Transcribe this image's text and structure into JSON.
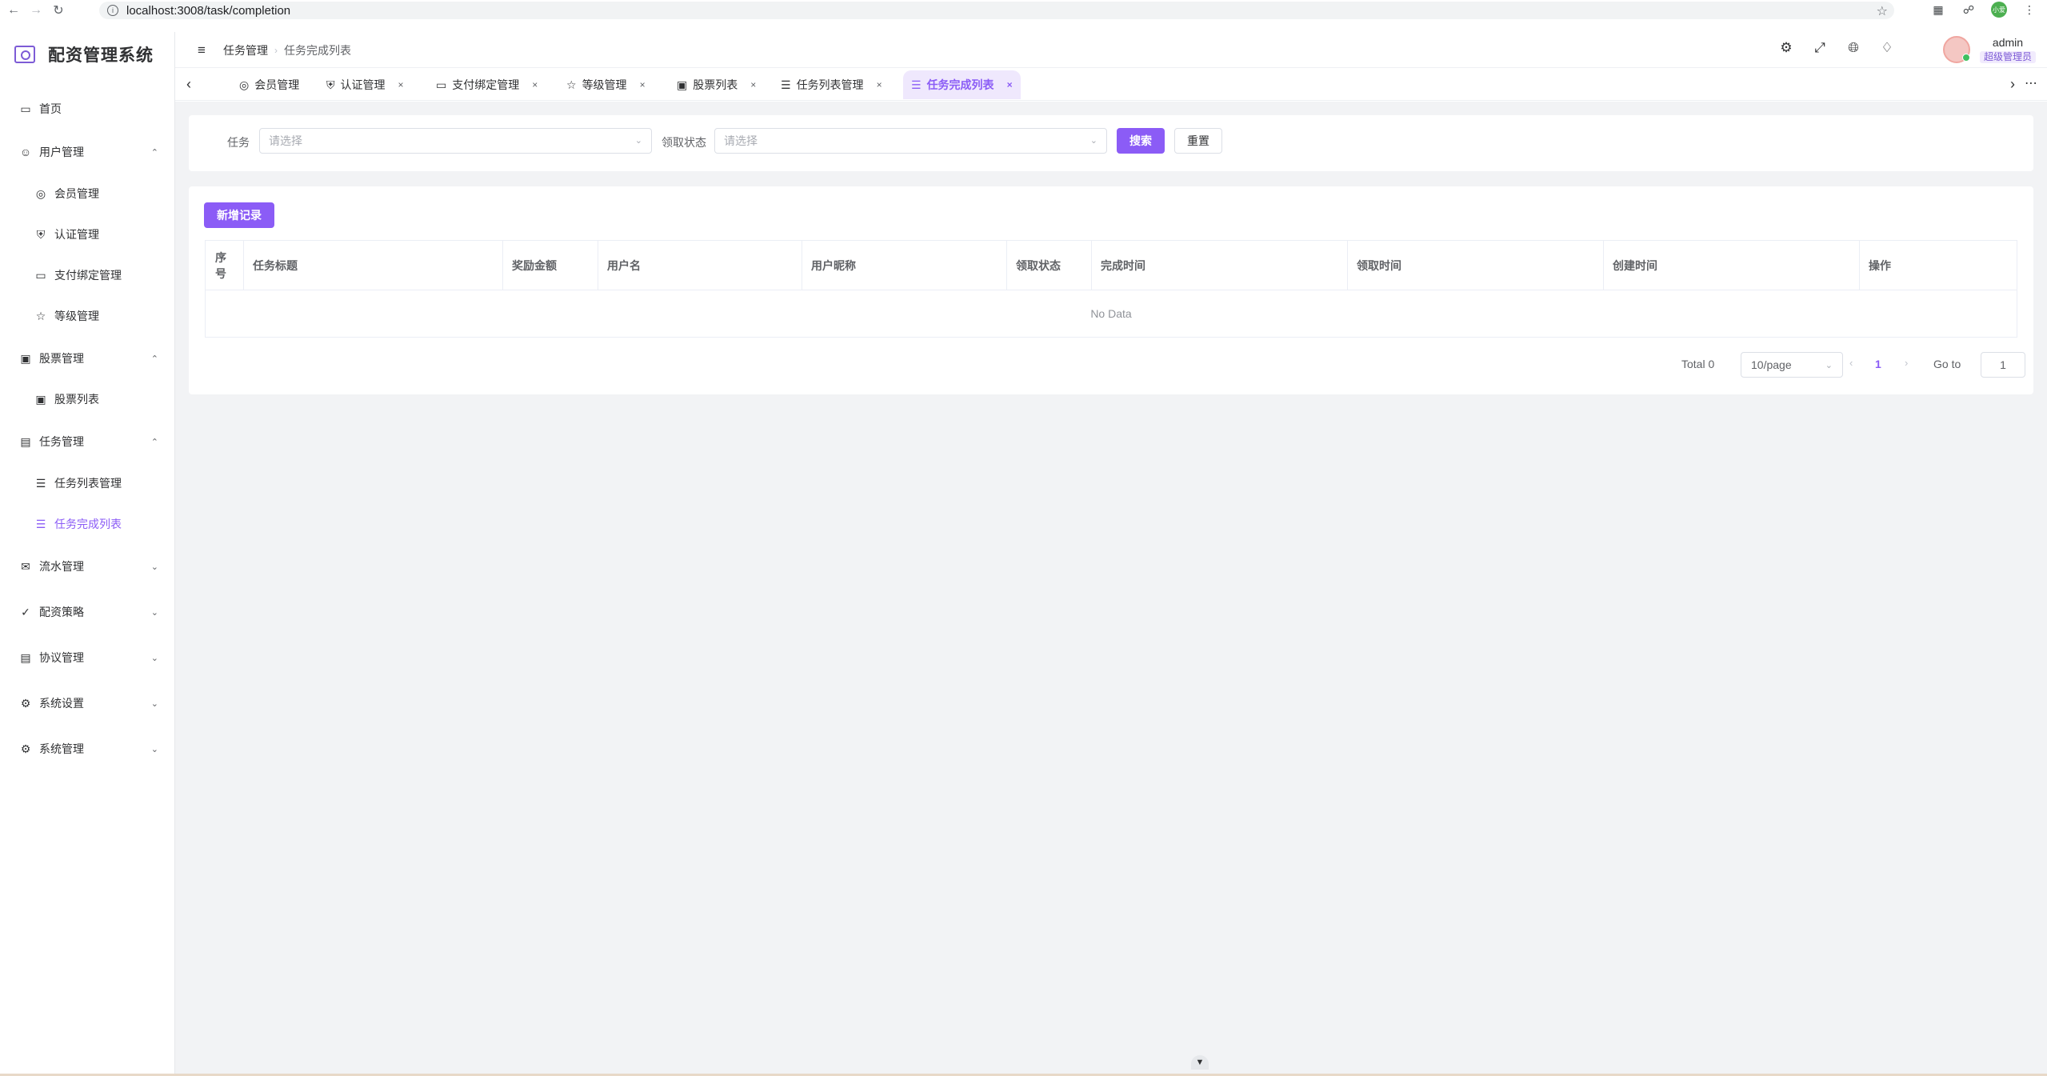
{
  "browser": {
    "url": "localhost:3008/task/completion",
    "profile_label": "小爱"
  },
  "app": {
    "title": "配资管理系统"
  },
  "sidebar": {
    "items": [
      {
        "label": "首页",
        "icon": "monitor-icon",
        "level": 1,
        "caret": ""
      },
      {
        "label": "用户管理",
        "icon": "users-icon",
        "level": 1,
        "caret": "up"
      },
      {
        "label": "会员管理",
        "icon": "user-circle-icon",
        "level": 2,
        "caret": ""
      },
      {
        "label": "认证管理",
        "icon": "shield-icon",
        "level": 2,
        "caret": ""
      },
      {
        "label": "支付绑定管理",
        "icon": "credit-card-icon",
        "level": 2,
        "caret": ""
      },
      {
        "label": "等级管理",
        "icon": "star-icon",
        "level": 2,
        "caret": ""
      },
      {
        "label": "股票管理",
        "icon": "chart-icon",
        "level": 1,
        "caret": "up"
      },
      {
        "label": "股票列表",
        "icon": "chart-icon",
        "level": 2,
        "caret": ""
      },
      {
        "label": "任务管理",
        "icon": "clipboard-icon",
        "level": 1,
        "caret": "up"
      },
      {
        "label": "任务列表管理",
        "icon": "list-icon",
        "level": 2,
        "caret": ""
      },
      {
        "label": "任务完成列表",
        "icon": "list-icon",
        "level": 2,
        "caret": "",
        "active": true
      },
      {
        "label": "流水管理",
        "icon": "inbox-icon",
        "level": 1,
        "caret": "down"
      },
      {
        "label": "配资策略",
        "icon": "strategy-icon",
        "level": 1,
        "caret": "down"
      },
      {
        "label": "协议管理",
        "icon": "document-icon",
        "level": 1,
        "caret": "down"
      },
      {
        "label": "系统设置",
        "icon": "gear-icon",
        "level": 1,
        "caret": "down"
      },
      {
        "label": "系统管理",
        "icon": "gear-icon",
        "level": 1,
        "caret": "down"
      }
    ]
  },
  "header": {
    "breadcrumb": [
      "任务管理",
      "任务完成列表"
    ],
    "user": {
      "name": "admin",
      "role": "超级管理员"
    }
  },
  "tabs": [
    {
      "label": "会员管理",
      "icon": "user-circle-icon",
      "closable": false
    },
    {
      "label": "认证管理",
      "icon": "shield-icon",
      "closable": true
    },
    {
      "label": "支付绑定管理",
      "icon": "credit-card-icon",
      "closable": true
    },
    {
      "label": "等级管理",
      "icon": "star-icon",
      "closable": true
    },
    {
      "label": "股票列表",
      "icon": "chart-icon",
      "closable": true
    },
    {
      "label": "任务列表管理",
      "icon": "list-icon",
      "closable": true
    },
    {
      "label": "任务完成列表",
      "icon": "list-icon",
      "closable": true,
      "active": true
    }
  ],
  "search": {
    "task_label": "任务",
    "task_placeholder": "请选择",
    "status_label": "领取状态",
    "status_placeholder": "请选择",
    "search_button": "搜索",
    "reset_button": "重置"
  },
  "table": {
    "add_button": "新增记录",
    "columns": [
      "序号",
      "任务标题",
      "奖励金额",
      "用户名",
      "用户昵称",
      "领取状态",
      "完成时间",
      "领取时间",
      "创建时间",
      "操作"
    ],
    "empty_text": "No Data"
  },
  "pagination": {
    "total_text": "Total 0",
    "page_size": "10/page",
    "current_page": "1",
    "goto_label": "Go to",
    "goto_value": "1"
  },
  "colors": {
    "accent": "#8b5cf6",
    "active_tab_bg": "#efe8fd",
    "main_bg": "#f2f3f5"
  }
}
